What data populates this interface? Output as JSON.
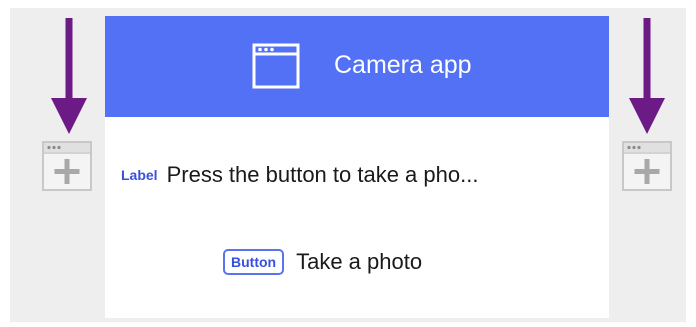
{
  "app_header": {
    "title": "Camera app",
    "icon": "window-icon",
    "color": "#5271f5"
  },
  "label_component": {
    "tag": "Label",
    "text": "Press the button to take a pho..."
  },
  "button_component": {
    "tag": "Button",
    "text": "Take a photo"
  },
  "insert_controls": {
    "left_icon": "add-window-icon",
    "right_icon": "add-window-icon",
    "arrow_color": "#6b1a86"
  }
}
